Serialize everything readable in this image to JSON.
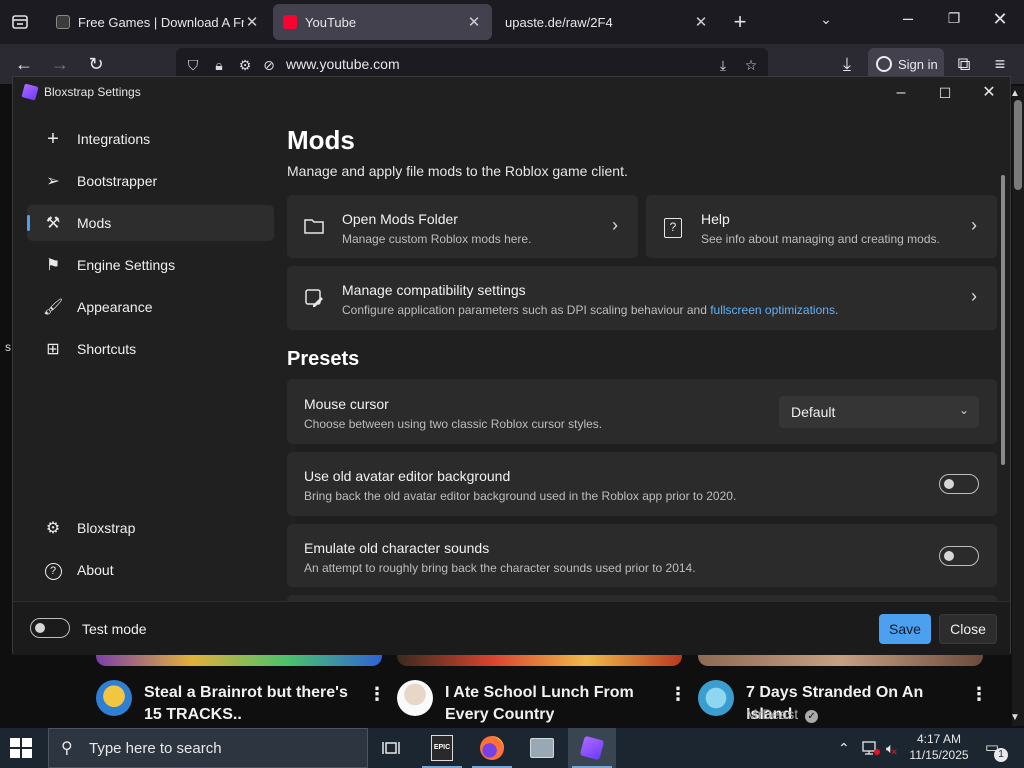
{
  "browser": {
    "tabs": [
      {
        "title": "Free Games | Download A Free",
        "favicon": "epic-games-icon"
      },
      {
        "title": "YouTube",
        "favicon": "youtube-icon"
      },
      {
        "title": "upaste.de/raw/2F4",
        "favicon": "none"
      }
    ],
    "url": "www.youtube.com",
    "sign_in_label": "Sign in"
  },
  "youtube": {
    "videos": [
      {
        "title": "Steal a Brainrot but there's 15 TRACKS..",
        "channel": ""
      },
      {
        "title": "I Ate School Lunch From Every Country",
        "channel": ""
      },
      {
        "title": "7 Days Stranded On An Island",
        "channel": "MrBeast",
        "verified": true
      }
    ],
    "side_glyph": "s"
  },
  "bloxstrap": {
    "window_title": "Bloxstrap Settings",
    "sidebar": {
      "items": [
        {
          "label": "Integrations",
          "icon": "plus-icon"
        },
        {
          "label": "Bootstrapper",
          "icon": "rocket-icon"
        },
        {
          "label": "Mods",
          "icon": "wrench-screwdriver-icon",
          "active": true
        },
        {
          "label": "Engine Settings",
          "icon": "flag-icon"
        },
        {
          "label": "Appearance",
          "icon": "paint-brush-icon"
        },
        {
          "label": "Shortcuts",
          "icon": "apps-icon"
        }
      ],
      "bottom_items": [
        {
          "label": "Bloxstrap",
          "icon": "gear-icon"
        },
        {
          "label": "About",
          "icon": "question-circle-icon"
        }
      ]
    },
    "page": {
      "title": "Mods",
      "subtitle": "Manage and apply file mods to the Roblox game client."
    },
    "cards": {
      "open_mods": {
        "title": "Open Mods Folder",
        "desc": "Manage custom Roblox mods here."
      },
      "help": {
        "title": "Help",
        "desc": "See info about managing and creating mods."
      },
      "compat": {
        "title": "Manage compatibility settings",
        "desc_prefix": "Configure application parameters such as DPI scaling behaviour and ",
        "link": "fullscreen optimizations",
        "desc_suffix": "."
      }
    },
    "presets": {
      "heading": "Presets",
      "mouse_cursor": {
        "title": "Mouse cursor",
        "desc": "Choose between using two classic Roblox cursor styles.",
        "selected": "Default"
      },
      "avatar_bg": {
        "title": "Use old avatar editor background",
        "desc": "Bring back the old avatar editor background used in the Roblox app prior to 2020.",
        "on": false
      },
      "char_sounds": {
        "title": "Emulate old character sounds",
        "desc": "An attempt to roughly bring back the character sounds used prior to 2014.",
        "on": false
      }
    },
    "footer": {
      "test_mode_label": "Test mode",
      "test_mode_on": false,
      "save_label": "Save",
      "close_label": "Close"
    },
    "colors": {
      "accent": "#4ca0f0",
      "link": "#60b2f5"
    }
  },
  "taskbar": {
    "search_placeholder": "Type here to search",
    "time": "4:17 AM",
    "date": "11/15/2025",
    "notification_count": "1"
  }
}
